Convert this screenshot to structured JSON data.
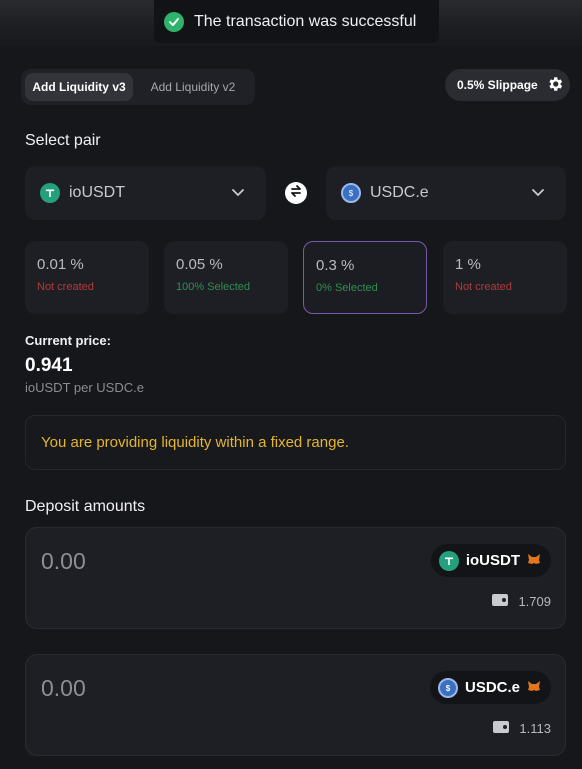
{
  "toast": {
    "message": "The transaction was successful",
    "icon": "check-circle-icon"
  },
  "tabs": [
    {
      "label": "Add Liquidity v3",
      "active": true
    },
    {
      "label": "Add Liquidity v2",
      "active": false
    }
  ],
  "slippage": {
    "label": "0.5% Slippage",
    "icon": "gear-icon"
  },
  "select_pair": {
    "title": "Select pair",
    "token_a": {
      "symbol": "ioUSDT",
      "icon": "tether-icon"
    },
    "token_b": {
      "symbol": "USDC.e",
      "icon": "usdc-icon"
    }
  },
  "fee_tiers": [
    {
      "percent": "0.01 %",
      "status": "Not created",
      "status_color": "#b23a3a"
    },
    {
      "percent": "0.05 %",
      "status": "100% Selected",
      "status_color": "#2f8f4e"
    },
    {
      "percent": "0.3 %",
      "status": "0% Selected",
      "status_color": "#2f8f4e",
      "selected": true
    },
    {
      "percent": "1 %",
      "status": "Not created",
      "status_color": "#b23a3a"
    }
  ],
  "current_price": {
    "label": "Current price:",
    "value": "0.941",
    "unit": "ioUSDT per USDC.e"
  },
  "notice": "You are providing liquidity within a fixed range.",
  "deposit": {
    "title": "Deposit amounts",
    "items": [
      {
        "amount": "0.00",
        "symbol": "ioUSDT",
        "balance": "1.709"
      },
      {
        "amount": "0.00",
        "symbol": "USDC.e",
        "balance": "1.113"
      }
    ]
  },
  "colors": {
    "accent_purple": "#7a5aa8",
    "warning_yellow": "#e5b52e",
    "success_green": "#2fb36b"
  }
}
